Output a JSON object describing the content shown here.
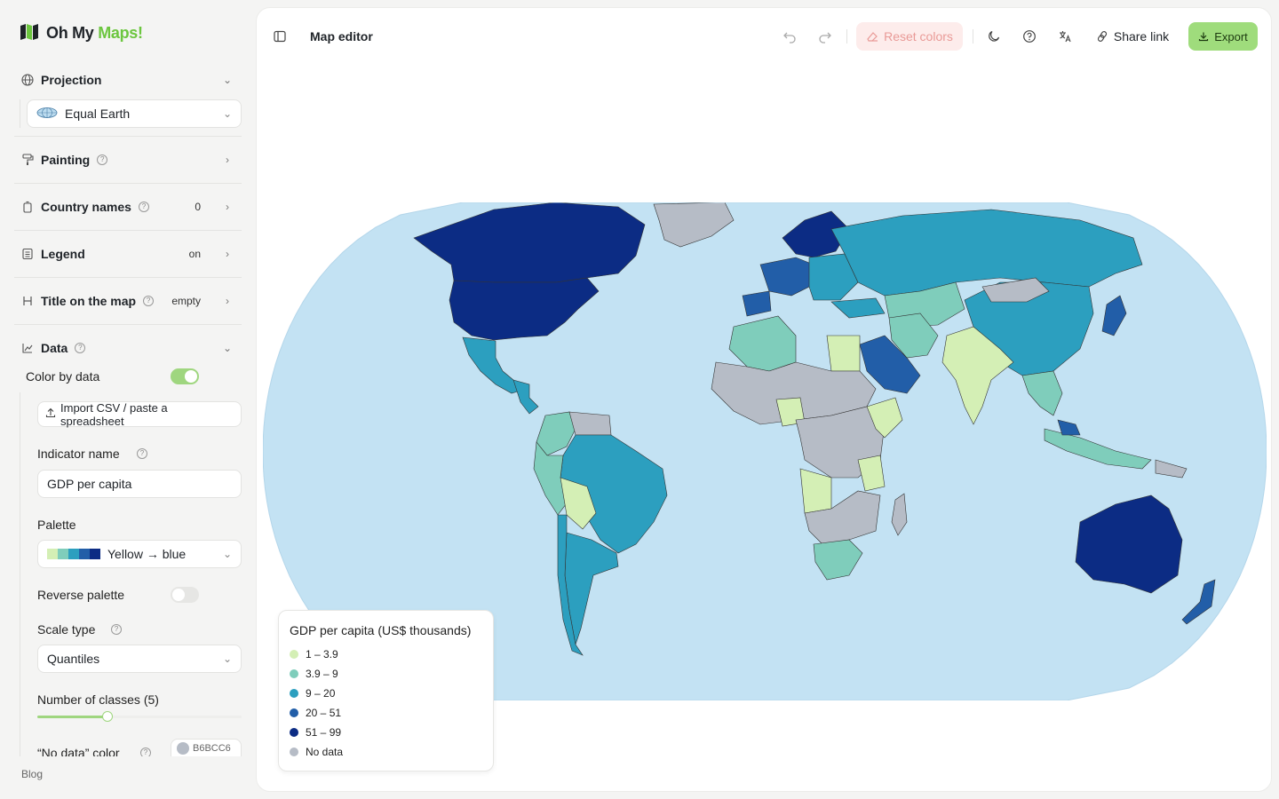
{
  "app": {
    "logo_text_1": "Oh My ",
    "logo_text_2": "Maps!",
    "brand_color": "#6cc63f"
  },
  "sidebar": {
    "projection": {
      "title": "Projection",
      "selected": "Equal Earth"
    },
    "painting": {
      "title": "Painting"
    },
    "country_names": {
      "title": "Country names",
      "value": "0"
    },
    "legend": {
      "title": "Legend",
      "value": "on"
    },
    "map_title": {
      "title": "Title on the map",
      "value": "empty"
    },
    "data": {
      "title": "Data",
      "color_by_data": {
        "label": "Color by data",
        "enabled": true
      },
      "import_label": "Import CSV / paste a spreadsheet",
      "indicator_label": "Indicator name",
      "indicator_value": "GDP per capita",
      "palette_label": "Palette",
      "palette_value": "Yellow → blue",
      "palette_colors": [
        "#d4efb5",
        "#7fcdbb",
        "#2c9fbf",
        "#225ea8",
        "#0c2c84"
      ],
      "reverse_label": "Reverse palette",
      "reverse_enabled": false,
      "scale_label": "Scale type",
      "scale_value": "Quantiles",
      "classes_label": "Number of classes (5)",
      "classes_value": 5,
      "no_data_label": "“No data” color",
      "no_data_color": "B6BCC6"
    },
    "blog": "Blog"
  },
  "topbar": {
    "title": "Map editor",
    "reset_label": "Reset colors",
    "share_label": "Share link",
    "export_label": "Export"
  },
  "legend": {
    "title": "GDP per capita (US$ thousands)",
    "items": [
      {
        "label": "1 – 3.9",
        "color": "#d4efb5"
      },
      {
        "label": "3.9 – 9",
        "color": "#7fcdbb"
      },
      {
        "label": "9 – 20",
        "color": "#2c9fbf"
      },
      {
        "label": "20 – 51",
        "color": "#225ea8"
      },
      {
        "label": "51 – 99",
        "color": "#0c2c84"
      },
      {
        "label": "No data",
        "color": "#b6bcc6"
      }
    ]
  },
  "map": {
    "ocean_color": "#c3e2f3"
  }
}
